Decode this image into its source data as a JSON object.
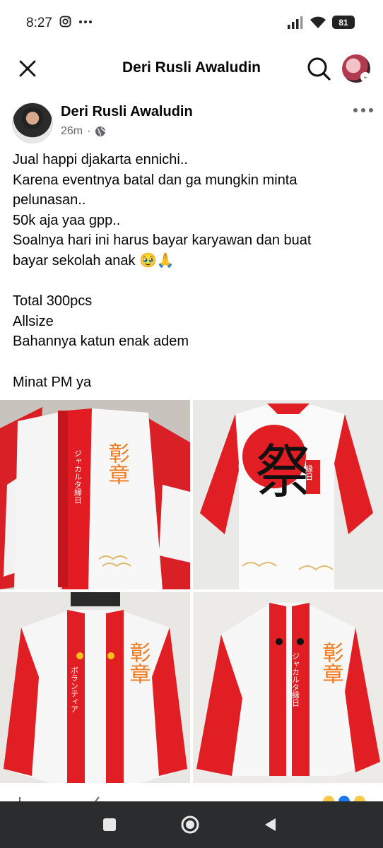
{
  "status_bar": {
    "time": "8:27",
    "battery": "81",
    "icons": [
      "instagram-icon",
      "more-dots-icon",
      "signal-icon",
      "wifi-icon",
      "battery-icon"
    ]
  },
  "header": {
    "title": "Deri Rusli Awaludin",
    "icons": [
      "close-icon",
      "search-icon",
      "profile-avatar"
    ]
  },
  "post": {
    "author": "Deri Rusli Awaludin",
    "time": "26m",
    "audience_icon": "globe-icon",
    "lines": [
      "Jual happi djakarta ennichi..",
      "Karena eventnya batal dan ga mungkin minta",
      "pelunasan..",
      "50k aja yaa gpp..",
      "Soalnya hari ini harus bayar karyawan dan buat",
      "bayar sekolah anak 🥹🙏",
      "",
      "Total 300pcs",
      "Allsize",
      "Bahannya katun enak adem",
      "",
      "Minat PM ya"
    ],
    "photos": {
      "p1_vertical": "ジャカルタ縁日",
      "p2_kanji": "祭",
      "p2_vertical": "縁日",
      "p3_vertical": "ボランティア",
      "p4_vertical": "ジャカルタ縁日",
      "sleeve_kanji": "彰章"
    }
  },
  "nav_bar": {
    "buttons": [
      "recents-button",
      "home-button",
      "back-button"
    ]
  },
  "colors": {
    "red": "#e0191f",
    "white": "#ffffff",
    "orange": "#f07a1c",
    "meta_gray": "#65676b",
    "nav_bg": "#2b2c2e"
  }
}
